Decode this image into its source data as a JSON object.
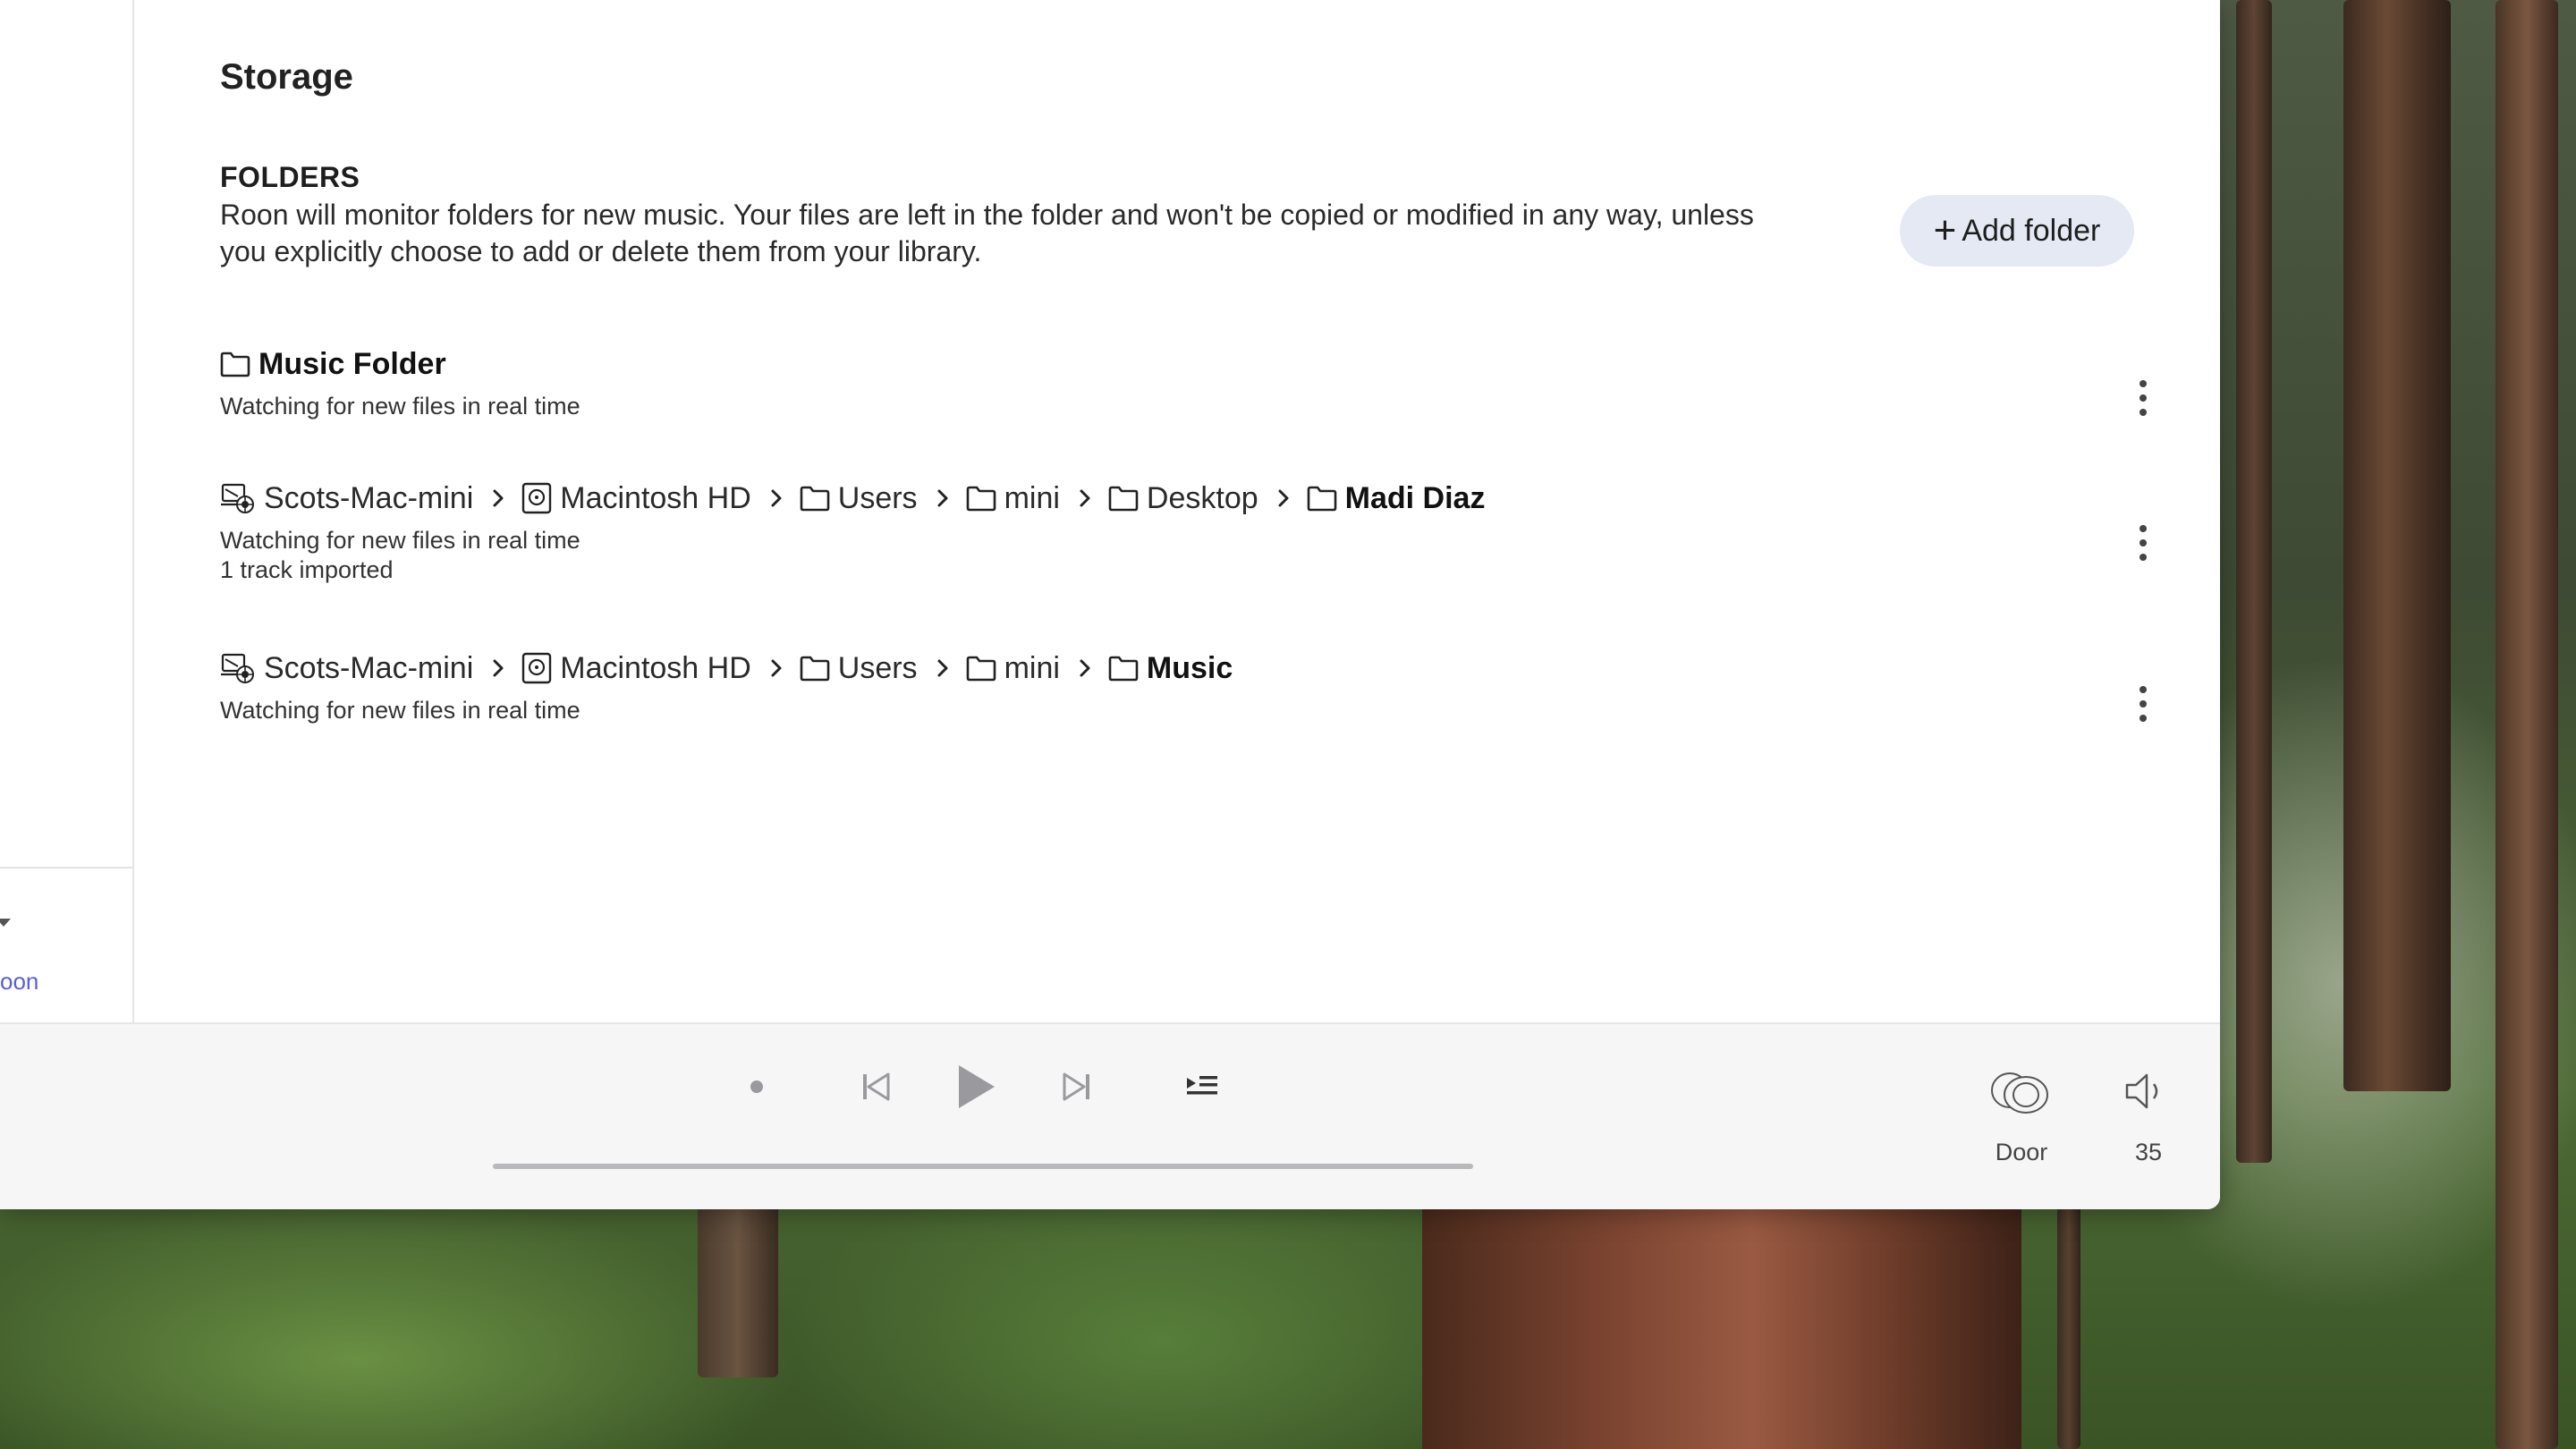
{
  "page": {
    "title": "Storage"
  },
  "sidebar": {
    "link_text": "oon"
  },
  "folders_section": {
    "heading": "FOLDERS",
    "description": "Roon will monitor folders for new music. Your files are left in the folder and won't be copied or modified in any way, unless you explicitly choose to add or delete them from your library.",
    "add_button_label": "Add folder"
  },
  "folders": [
    {
      "path": [
        {
          "icon": "folder-icon",
          "label": "Music Folder",
          "bold": true
        }
      ],
      "status": [
        "Watching for new files in real time"
      ]
    },
    {
      "path": [
        {
          "icon": "computer-icon",
          "label": "Scots-Mac-mini",
          "bold": false
        },
        {
          "icon": "hard-drive-icon",
          "label": "Macintosh HD",
          "bold": false
        },
        {
          "icon": "folder-icon",
          "label": "Users",
          "bold": false
        },
        {
          "icon": "folder-icon",
          "label": "mini",
          "bold": false
        },
        {
          "icon": "folder-icon",
          "label": "Desktop",
          "bold": false
        },
        {
          "icon": "folder-icon",
          "label": "Madi Diaz",
          "bold": true
        }
      ],
      "status": [
        "Watching for new files in real time",
        "1 track imported"
      ]
    },
    {
      "path": [
        {
          "icon": "computer-icon",
          "label": "Scots-Mac-mini",
          "bold": false
        },
        {
          "icon": "hard-drive-icon",
          "label": "Macintosh HD",
          "bold": false
        },
        {
          "icon": "folder-icon",
          "label": "Users",
          "bold": false
        },
        {
          "icon": "folder-icon",
          "label": "mini",
          "bold": false
        },
        {
          "icon": "folder-icon",
          "label": "Music",
          "bold": true
        }
      ],
      "status": [
        "Watching for new files in real time"
      ]
    }
  ],
  "player": {
    "zone_name": "Door",
    "volume": "35",
    "progress": 0
  },
  "colors": {
    "accent_link": "#5a5fd6",
    "button_bg": "#e4e9f3"
  }
}
